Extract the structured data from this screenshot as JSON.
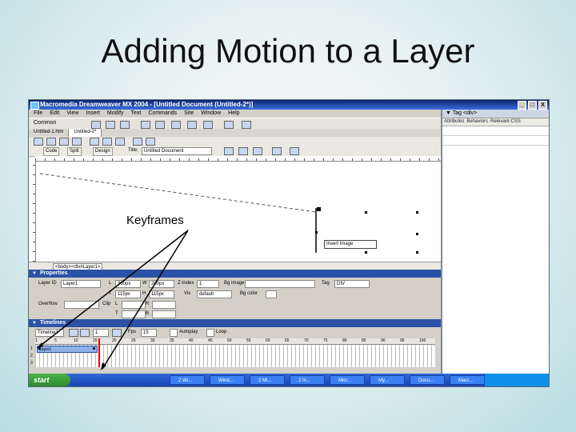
{
  "slide": {
    "title": "Adding Motion to a Layer",
    "callout": "Keyframes"
  },
  "app": {
    "title": "Macromedia Dreamweaver MX 2004 - [Untitled Document (Untitled-2*)]",
    "window_buttons": [
      "_",
      "□",
      "X"
    ],
    "menu": [
      "File",
      "Edit",
      "View",
      "Insert",
      "Modify",
      "Text",
      "Commands",
      "Site",
      "Window",
      "Help"
    ],
    "insert_category": "Common",
    "doc_tabs": [
      "Untitled-1.htm",
      "Untitled-2*"
    ],
    "view_buttons": [
      "Code",
      "Split",
      "Design"
    ],
    "title_label": "Title:",
    "title_value": "Untitled Document",
    "layer_name": "Insert Image",
    "status_tag": "<body><div#Layer1>"
  },
  "right_panel": {
    "header": "▼ Tag <div>",
    "tabs": [
      "Attributes",
      "Behaviors",
      "Relevant CSS"
    ]
  },
  "properties": {
    "header": "Properties",
    "layer_id_label": "Layer ID",
    "layer_id_value": "Layer1",
    "left_label": "L",
    "left_value": "360px",
    "width_label": "W",
    "width_value": "200px",
    "top_label": "T",
    "top_value": "115px",
    "height_label": "H",
    "height_value": "115px",
    "z_label": "Z-Index",
    "z_value": "1",
    "bg_image_label": "Bg image",
    "vis_label": "Vis",
    "vis_value": "default",
    "bg_color_label": "Bg color",
    "tag_label": "Tag",
    "tag_value": "DIV",
    "overflow_label": "Overflow",
    "clip_label": "Clip",
    "clip_l": "L",
    "clip_t": "T",
    "clip_r": "R",
    "clip_b": "B"
  },
  "timeline": {
    "header": "Timelines",
    "name": "Timeline1",
    "frame_value": "1",
    "fps_label": "Fps",
    "fps_value": "15",
    "autoplay_label": "Autoplay",
    "loop_label": "Loop",
    "anim_bar_label": "Layer1",
    "ruler": [
      "1",
      "5",
      "10",
      "15",
      "20",
      "25",
      "30",
      "35",
      "40",
      "45",
      "50",
      "55",
      "60",
      "65",
      "70",
      "75",
      "80",
      "85",
      "90",
      "95",
      "100"
    ],
    "row_numbers": [
      "1",
      "2",
      "3"
    ]
  },
  "taskbar": {
    "start_label": "start",
    "items": [
      "2 Wi...",
      "Wind...",
      "2 Mi...",
      "2 In...",
      "Micr...",
      "My...",
      "Docu...",
      "Macr..."
    ]
  }
}
